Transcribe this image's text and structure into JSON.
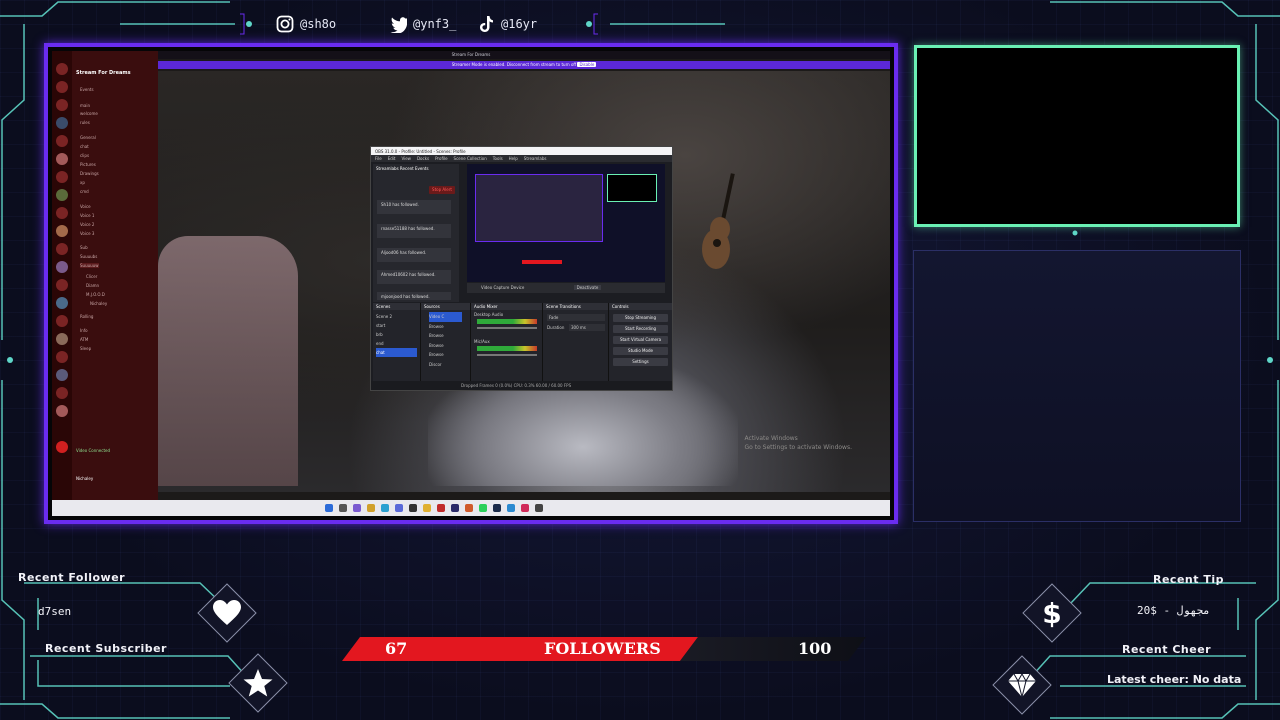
{
  "socials": [
    {
      "icon": "instagram-icon",
      "handle": "@sh8o"
    },
    {
      "icon": "twitter-icon",
      "handle": "@ynf3_"
    },
    {
      "icon": "tiktok-icon",
      "handle": "@16yr"
    }
  ],
  "screen_capture": {
    "window_title": "Stream For Dreams",
    "banner_text": "Streamer Mode is enabled. Disconnect from stream to turn off",
    "banner_button": "Disable",
    "discord": {
      "server_name": "Stream For Dreams",
      "channels": [
        "Events",
        "main",
        "welcome",
        "rules",
        "General",
        "chat",
        "clips",
        "Pictures",
        "Drawings",
        "xp",
        "cmd",
        "Voice",
        "Voice 1",
        "Voice 2",
        "Voice 3",
        "Sub",
        "Suuuubs",
        "Suuuuuw",
        "Clicer",
        "Diamn",
        "M.J.O.O.D",
        "Nichaley",
        "Rolling",
        "Info",
        "ATM",
        "Sleep"
      ],
      "voice_status": "Video Connected",
      "user": "Nichaley"
    },
    "activate_windows": [
      "Activate Windows",
      "Go to Settings to activate Windows."
    ]
  },
  "obs": {
    "title": "OBS 31.0.0 - Profile: Untitled - Scenes: Profile",
    "menu": [
      "File",
      "Edit",
      "View",
      "Docks",
      "Profile",
      "Scene Collection",
      "Tools",
      "Help",
      "Streamlabs"
    ],
    "events_title": "Streamlabs Recent Events",
    "stop_btn": "Stop Alert",
    "events": [
      "Sh10 has followed.",
      "rnasse51188 has followed.",
      "Aljood06 has followed.",
      "Ahmed10602 has followed.",
      "mjoonjood has followed."
    ],
    "source_bar": [
      "Video Capture Device",
      "Deactivate"
    ],
    "docks": [
      "Scenes",
      "Sources",
      "Audio Mixer",
      "Scene Transitions",
      "Controls"
    ],
    "scenes": [
      "Scene 2",
      "start",
      "brb",
      "end",
      "chat"
    ],
    "sources": [
      "Video C",
      "Browse",
      "Browse",
      "Browse",
      "Browse",
      "Discor"
    ],
    "mixer": [
      "Desktop Audio",
      "Mic/Aux"
    ],
    "transition": [
      "Fade",
      "Duration",
      "300 ms"
    ],
    "controls": [
      "Stop Streaming",
      "Start Recording",
      "Start Virtual Camera",
      "Studio Mode",
      "Settings"
    ],
    "status": "Dropped Frames 0 (0.0%)   CPU: 0.3%   60.00 / 60.00 FPS"
  },
  "recent_follower": {
    "label": "Recent Follower",
    "value": "d7sen",
    "icon": "heart-icon"
  },
  "recent_subscriber": {
    "label": "Recent Subscriber",
    "value": "",
    "icon": "star-icon"
  },
  "recent_tip": {
    "label": "Recent Tip",
    "value": "20$ - مجهول",
    "icon": "dollar-icon"
  },
  "recent_cheer": {
    "label": "Recent Cheer",
    "value": "Latest cheer: No data",
    "icon": "diamond-icon"
  },
  "goal": {
    "current": "67",
    "label": "FOLLOWERS",
    "target": "100",
    "progress": 0.67
  },
  "colors": {
    "accent_purple": "#6a2cf0",
    "accent_green": "#6af0b4",
    "goal_red": "#e3171f",
    "frame_cyan": "#5fd6c8"
  }
}
